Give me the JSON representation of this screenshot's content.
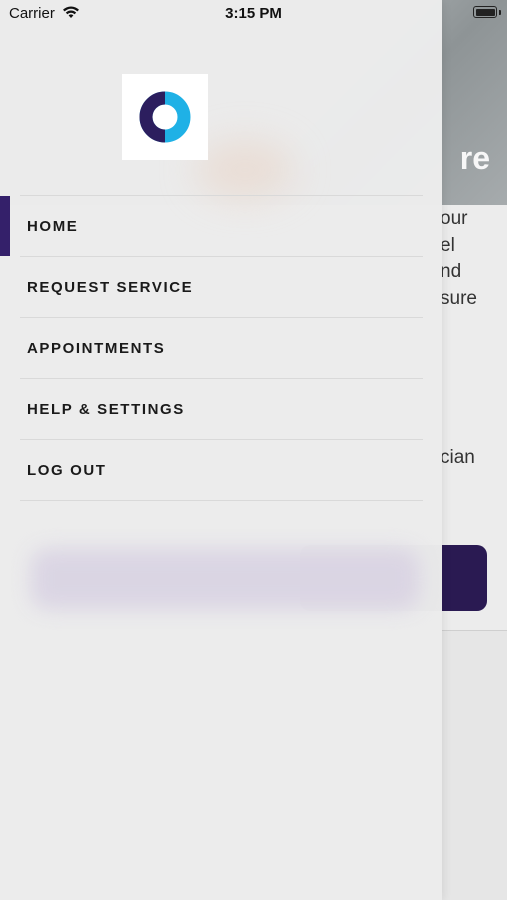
{
  "status_bar": {
    "carrier": "Carrier",
    "time": "3:15 PM"
  },
  "background": {
    "hero_title_fragment": "re",
    "text_fragments": [
      "our",
      "el",
      "nd",
      "sure",
      "cian"
    ]
  },
  "drawer": {
    "menu": [
      {
        "label": "HOME",
        "active": true
      },
      {
        "label": "REQUEST SERVICE",
        "active": false
      },
      {
        "label": "APPOINTMENTS",
        "active": false
      },
      {
        "label": "HELP & SETTINGS",
        "active": false
      },
      {
        "label": "LOG OUT",
        "active": false
      }
    ]
  },
  "colors": {
    "accent": "#34206a",
    "logo_dark": "#2c1e5e",
    "logo_light": "#1fb1e6",
    "cta": "#2a1a52"
  }
}
